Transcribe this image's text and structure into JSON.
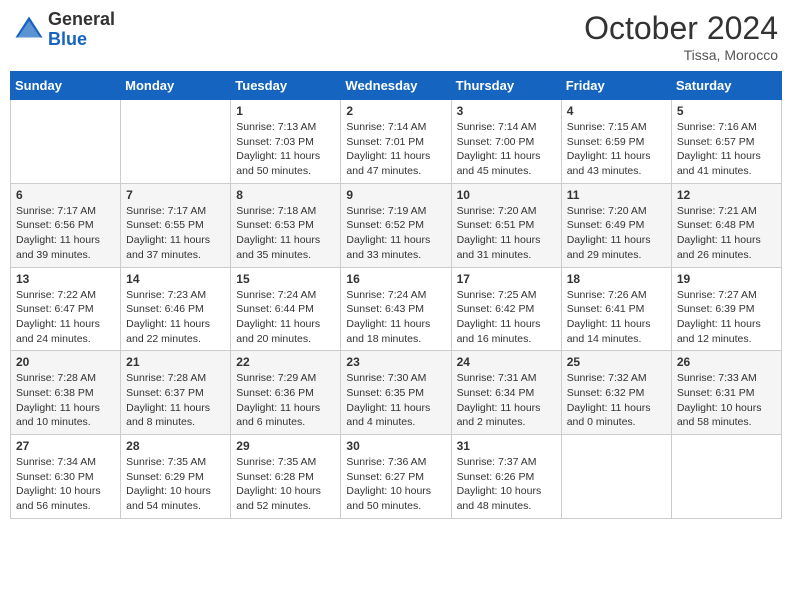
{
  "logo": {
    "general": "General",
    "blue": "Blue"
  },
  "title": "October 2024",
  "location": "Tissa, Morocco",
  "weekdays": [
    "Sunday",
    "Monday",
    "Tuesday",
    "Wednesday",
    "Thursday",
    "Friday",
    "Saturday"
  ],
  "weeks": [
    [
      {
        "day": "",
        "info": ""
      },
      {
        "day": "",
        "info": ""
      },
      {
        "day": "1",
        "info": "Sunrise: 7:13 AM\nSunset: 7:03 PM\nDaylight: 11 hours and 50 minutes."
      },
      {
        "day": "2",
        "info": "Sunrise: 7:14 AM\nSunset: 7:01 PM\nDaylight: 11 hours and 47 minutes."
      },
      {
        "day": "3",
        "info": "Sunrise: 7:14 AM\nSunset: 7:00 PM\nDaylight: 11 hours and 45 minutes."
      },
      {
        "day": "4",
        "info": "Sunrise: 7:15 AM\nSunset: 6:59 PM\nDaylight: 11 hours and 43 minutes."
      },
      {
        "day": "5",
        "info": "Sunrise: 7:16 AM\nSunset: 6:57 PM\nDaylight: 11 hours and 41 minutes."
      }
    ],
    [
      {
        "day": "6",
        "info": "Sunrise: 7:17 AM\nSunset: 6:56 PM\nDaylight: 11 hours and 39 minutes."
      },
      {
        "day": "7",
        "info": "Sunrise: 7:17 AM\nSunset: 6:55 PM\nDaylight: 11 hours and 37 minutes."
      },
      {
        "day": "8",
        "info": "Sunrise: 7:18 AM\nSunset: 6:53 PM\nDaylight: 11 hours and 35 minutes."
      },
      {
        "day": "9",
        "info": "Sunrise: 7:19 AM\nSunset: 6:52 PM\nDaylight: 11 hours and 33 minutes."
      },
      {
        "day": "10",
        "info": "Sunrise: 7:20 AM\nSunset: 6:51 PM\nDaylight: 11 hours and 31 minutes."
      },
      {
        "day": "11",
        "info": "Sunrise: 7:20 AM\nSunset: 6:49 PM\nDaylight: 11 hours and 29 minutes."
      },
      {
        "day": "12",
        "info": "Sunrise: 7:21 AM\nSunset: 6:48 PM\nDaylight: 11 hours and 26 minutes."
      }
    ],
    [
      {
        "day": "13",
        "info": "Sunrise: 7:22 AM\nSunset: 6:47 PM\nDaylight: 11 hours and 24 minutes."
      },
      {
        "day": "14",
        "info": "Sunrise: 7:23 AM\nSunset: 6:46 PM\nDaylight: 11 hours and 22 minutes."
      },
      {
        "day": "15",
        "info": "Sunrise: 7:24 AM\nSunset: 6:44 PM\nDaylight: 11 hours and 20 minutes."
      },
      {
        "day": "16",
        "info": "Sunrise: 7:24 AM\nSunset: 6:43 PM\nDaylight: 11 hours and 18 minutes."
      },
      {
        "day": "17",
        "info": "Sunrise: 7:25 AM\nSunset: 6:42 PM\nDaylight: 11 hours and 16 minutes."
      },
      {
        "day": "18",
        "info": "Sunrise: 7:26 AM\nSunset: 6:41 PM\nDaylight: 11 hours and 14 minutes."
      },
      {
        "day": "19",
        "info": "Sunrise: 7:27 AM\nSunset: 6:39 PM\nDaylight: 11 hours and 12 minutes."
      }
    ],
    [
      {
        "day": "20",
        "info": "Sunrise: 7:28 AM\nSunset: 6:38 PM\nDaylight: 11 hours and 10 minutes."
      },
      {
        "day": "21",
        "info": "Sunrise: 7:28 AM\nSunset: 6:37 PM\nDaylight: 11 hours and 8 minutes."
      },
      {
        "day": "22",
        "info": "Sunrise: 7:29 AM\nSunset: 6:36 PM\nDaylight: 11 hours and 6 minutes."
      },
      {
        "day": "23",
        "info": "Sunrise: 7:30 AM\nSunset: 6:35 PM\nDaylight: 11 hours and 4 minutes."
      },
      {
        "day": "24",
        "info": "Sunrise: 7:31 AM\nSunset: 6:34 PM\nDaylight: 11 hours and 2 minutes."
      },
      {
        "day": "25",
        "info": "Sunrise: 7:32 AM\nSunset: 6:32 PM\nDaylight: 11 hours and 0 minutes."
      },
      {
        "day": "26",
        "info": "Sunrise: 7:33 AM\nSunset: 6:31 PM\nDaylight: 10 hours and 58 minutes."
      }
    ],
    [
      {
        "day": "27",
        "info": "Sunrise: 7:34 AM\nSunset: 6:30 PM\nDaylight: 10 hours and 56 minutes."
      },
      {
        "day": "28",
        "info": "Sunrise: 7:35 AM\nSunset: 6:29 PM\nDaylight: 10 hours and 54 minutes."
      },
      {
        "day": "29",
        "info": "Sunrise: 7:35 AM\nSunset: 6:28 PM\nDaylight: 10 hours and 52 minutes."
      },
      {
        "day": "30",
        "info": "Sunrise: 7:36 AM\nSunset: 6:27 PM\nDaylight: 10 hours and 50 minutes."
      },
      {
        "day": "31",
        "info": "Sunrise: 7:37 AM\nSunset: 6:26 PM\nDaylight: 10 hours and 48 minutes."
      },
      {
        "day": "",
        "info": ""
      },
      {
        "day": "",
        "info": ""
      }
    ]
  ]
}
